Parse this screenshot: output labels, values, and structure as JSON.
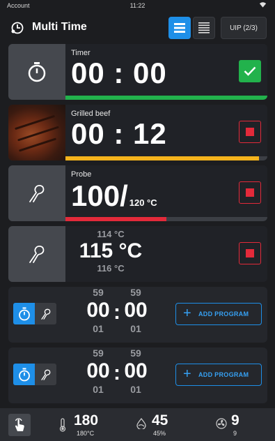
{
  "status_bar": {
    "carrier": "Account",
    "time": "11:22"
  },
  "header": {
    "title": "Multi Time",
    "uip_label": "UIP (2/3)"
  },
  "cards": [
    {
      "label": "Timer",
      "time": "00 : 00",
      "progress": 1.0,
      "progress_color": "#22b24c",
      "action": "done"
    },
    {
      "label": "Grilled beef",
      "time": "00 : 12",
      "progress": 0.96,
      "progress_color": "#f5b31c",
      "action": "stop"
    },
    {
      "label": "Probe",
      "value": "100/",
      "target": "120 °C",
      "progress": 0.5,
      "progress_color": "#e32a3a",
      "action": "stop"
    },
    {
      "above": "114 °C",
      "current": "115 °C",
      "below": "116 °C",
      "action": "stop"
    }
  ],
  "programs": [
    {
      "hours_above": "59",
      "hours": "00",
      "hours_below": "01",
      "minutes_above": "59",
      "minutes": "00",
      "minutes_below": "01",
      "colon": ":",
      "add_label": "ADD PROGRAM"
    },
    {
      "hours_above": "59",
      "hours": "00",
      "hours_below": "01",
      "minutes_above": "59",
      "minutes": "00",
      "minutes_below": "01",
      "colon": ":",
      "add_label": "ADD PROGRAM"
    }
  ],
  "bottom_bar": {
    "temperature": {
      "value": "180",
      "sub": "180°C",
      "icon": "thermometer-icon"
    },
    "humidity": {
      "value": "45",
      "sub": "45%",
      "icon": "humidity-icon"
    },
    "fan": {
      "value": "9",
      "sub": "9",
      "icon": "fan-icon"
    }
  },
  "colors": {
    "accent": "#1e8fe8",
    "success": "#22b24c",
    "warning": "#f5b31c",
    "danger": "#e32a3a"
  }
}
